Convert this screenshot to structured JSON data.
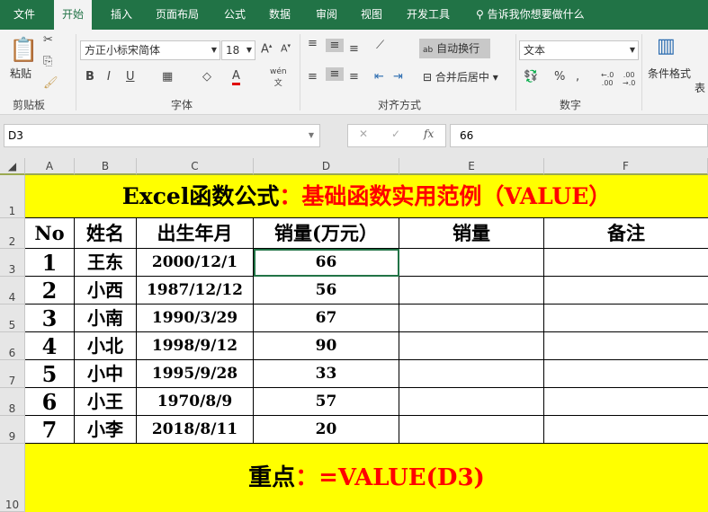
{
  "tabs": [
    "文件",
    "开始",
    "插入",
    "页面布局",
    "公式",
    "数据",
    "审阅",
    "视图",
    "开发工具"
  ],
  "tell_me": "告诉我你想要做什么",
  "ribbon": {
    "paste": "粘贴",
    "clipboard": "剪贴板",
    "font_name": "方正小标宋简体",
    "font_size": "18",
    "font": "字体",
    "wrap": "自动换行",
    "merge": "合并后居中",
    "alignment": "对齐方式",
    "number_format": "文本",
    "number": "数字",
    "cond_format": "条件格式",
    "table_partial": "表"
  },
  "formula_bar": {
    "name_box": "D3",
    "value": "66"
  },
  "columns": [
    "A",
    "B",
    "C",
    "D",
    "E",
    "F"
  ],
  "rows": [
    "1",
    "2",
    "3",
    "4",
    "5",
    "6",
    "7",
    "8",
    "9",
    "10"
  ],
  "sheet": {
    "title_black": "Excel函数公式",
    "title_red": "：基础函数实用范例（VALUE）",
    "headers": [
      "No",
      "姓名",
      "出生年月",
      "销量(万元）",
      "销量",
      "备注"
    ],
    "data": [
      [
        "1",
        "王东",
        "2000/12/1",
        "66"
      ],
      [
        "2",
        "小西",
        "1987/12/12",
        "56"
      ],
      [
        "3",
        "小南",
        "1990/3/29",
        "67"
      ],
      [
        "4",
        "小北",
        "1998/9/12",
        "90"
      ],
      [
        "5",
        "小中",
        "1995/9/28",
        "33"
      ],
      [
        "6",
        "小王",
        "1970/8/9",
        "57"
      ],
      [
        "7",
        "小李",
        "2018/8/11",
        "20"
      ]
    ],
    "note_black": "重点",
    "note_red": "：=VALUE(D3)"
  },
  "colors": {
    "excel_green": "#217346",
    "yellow": "#ffff00",
    "red": "#ff0000"
  }
}
